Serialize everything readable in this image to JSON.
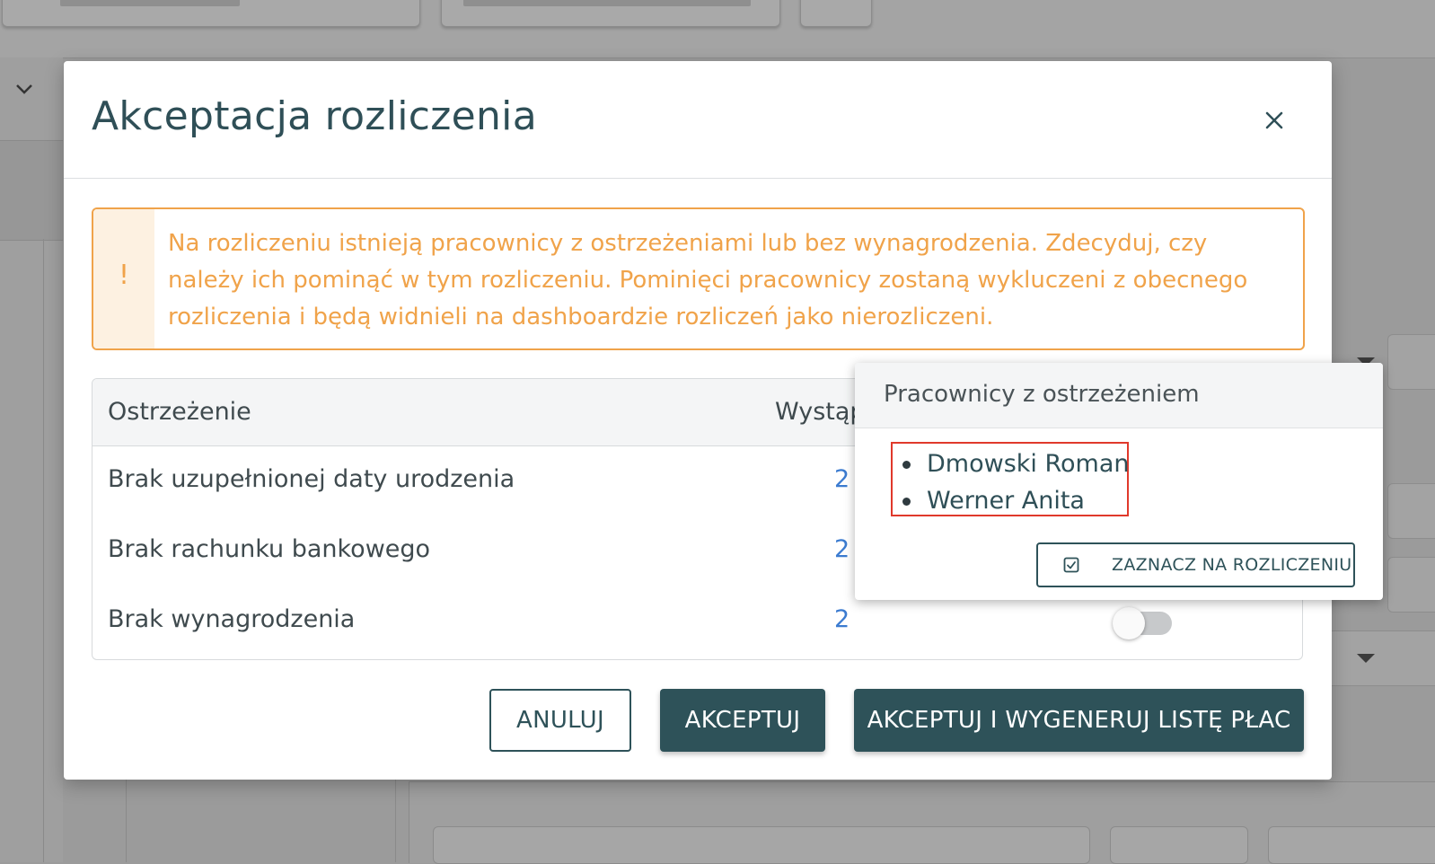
{
  "modal": {
    "title": "Akceptacja rozliczenia",
    "close_icon": "close-icon",
    "warning": {
      "icon": "!",
      "text": "Na rozliczeniu istnieją pracownicy z ostrzeżeniami lub bez wynagrodzenia. Zdecyduj, czy należy ich pominąć w tym rozliczeniu. Pominięci pracownicy zostaną wykluczeni z obecnego rozliczenia i będą widnieli na dashboardzie rozliczeń jako nierozliczeni."
    },
    "table": {
      "columns": [
        "Ostrzeżenie",
        "Wystąp"
      ],
      "rows": [
        {
          "warning": "Brak uzupełnionej daty urodzenia",
          "count": "2"
        },
        {
          "warning": "Brak rachunku bankowego",
          "count": "2"
        },
        {
          "warning": "Brak wynagrodzenia",
          "count": "2",
          "toggle_on": false
        }
      ]
    },
    "buttons": {
      "cancel": "ANULUJ",
      "accept": "AKCEPTUJ",
      "accept_generate": "AKCEPTUJ I WYGENERUJ LISTĘ PŁAC"
    }
  },
  "popover": {
    "title": "Pracownicy z ostrzeżeniem",
    "employees": [
      "Dmowski Roman",
      "Werner Anita"
    ],
    "mark_button": "ZAZNACZ NA ROZLICZENIU",
    "mark_icon": "checkbox-checked-icon"
  },
  "colors": {
    "primary": "#2e5259",
    "warning": "#f0a34a",
    "warning_bg": "#fdf1e1",
    "link": "#3b7bd0",
    "highlight": "#e0392b"
  }
}
